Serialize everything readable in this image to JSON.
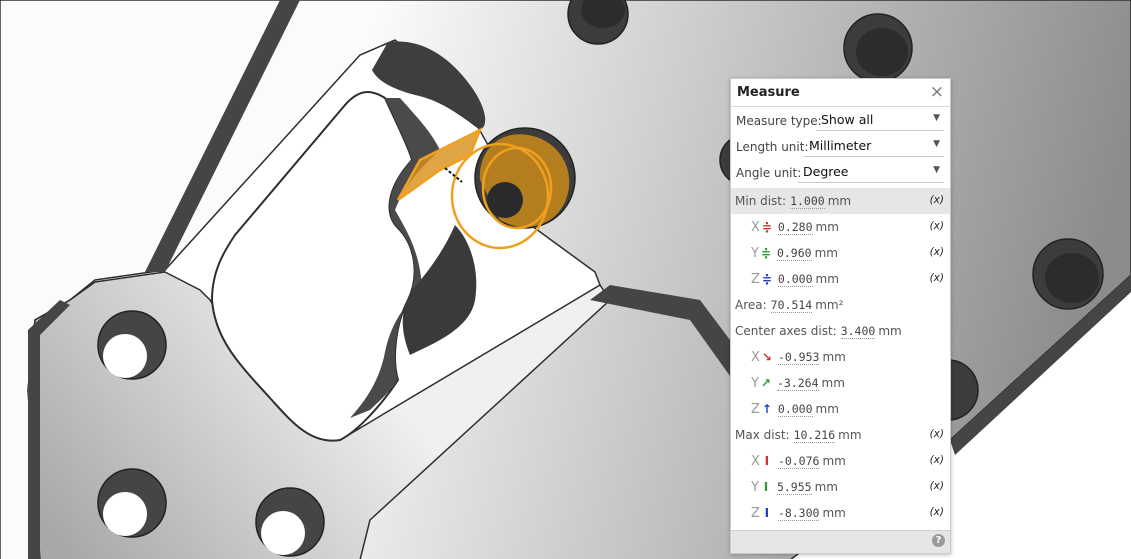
{
  "panel": {
    "title": "Measure",
    "close_glyph": "×",
    "help_glyph": "?",
    "settings": [
      {
        "label": "Measure type:",
        "value": "Show all"
      },
      {
        "label": "Length unit:",
        "value": "Millimeter"
      },
      {
        "label": "Angle unit:",
        "value": "Degree"
      }
    ],
    "dropdown_glyph": "▼",
    "fx_glyph": "(x)",
    "axis_letters": {
      "x": "X",
      "y": "Y",
      "z": "Z"
    },
    "min_dist": {
      "label": "Min dist:",
      "value": "1.000",
      "unit": "mm",
      "x": {
        "value": "0.280",
        "unit": "mm",
        "icon": "x-offset-arrows-icon"
      },
      "y": {
        "value": "0.960",
        "unit": "mm",
        "icon": "y-offset-arrows-icon"
      },
      "z": {
        "value": "0.000",
        "unit": "mm",
        "icon": "z-offset-arrows-icon"
      }
    },
    "area": {
      "label": "Area:",
      "value": "70.514",
      "unit": "mm²"
    },
    "center_axes_dist": {
      "label": "Center axes dist:",
      "value": "3.400",
      "unit": "mm",
      "x": {
        "value": "-0.953",
        "unit": "mm",
        "icon": "x-direction-arrow-icon"
      },
      "y": {
        "value": "-3.264",
        "unit": "mm",
        "icon": "y-direction-arrow-icon"
      },
      "z": {
        "value": "0.000",
        "unit": "mm",
        "icon": "z-direction-arrow-icon"
      }
    },
    "max_dist": {
      "label": "Max dist:",
      "value": "10.216",
      "unit": "mm",
      "x": {
        "value": "-0.076",
        "unit": "mm",
        "icon": "x-span-icon"
      },
      "y": {
        "value": "5.955",
        "unit": "mm",
        "icon": "y-span-icon"
      },
      "z": {
        "value": "-8.300",
        "unit": "mm",
        "icon": "z-span-icon"
      }
    }
  },
  "colors": {
    "axis_x": "#d0312d",
    "axis_y": "#2e9a3a",
    "axis_z": "#2040c8",
    "selection_orange": "#f0a020",
    "part_face_light": "#fafafa",
    "part_face_dark": "#8a8a8a",
    "part_wall": "#454545"
  }
}
